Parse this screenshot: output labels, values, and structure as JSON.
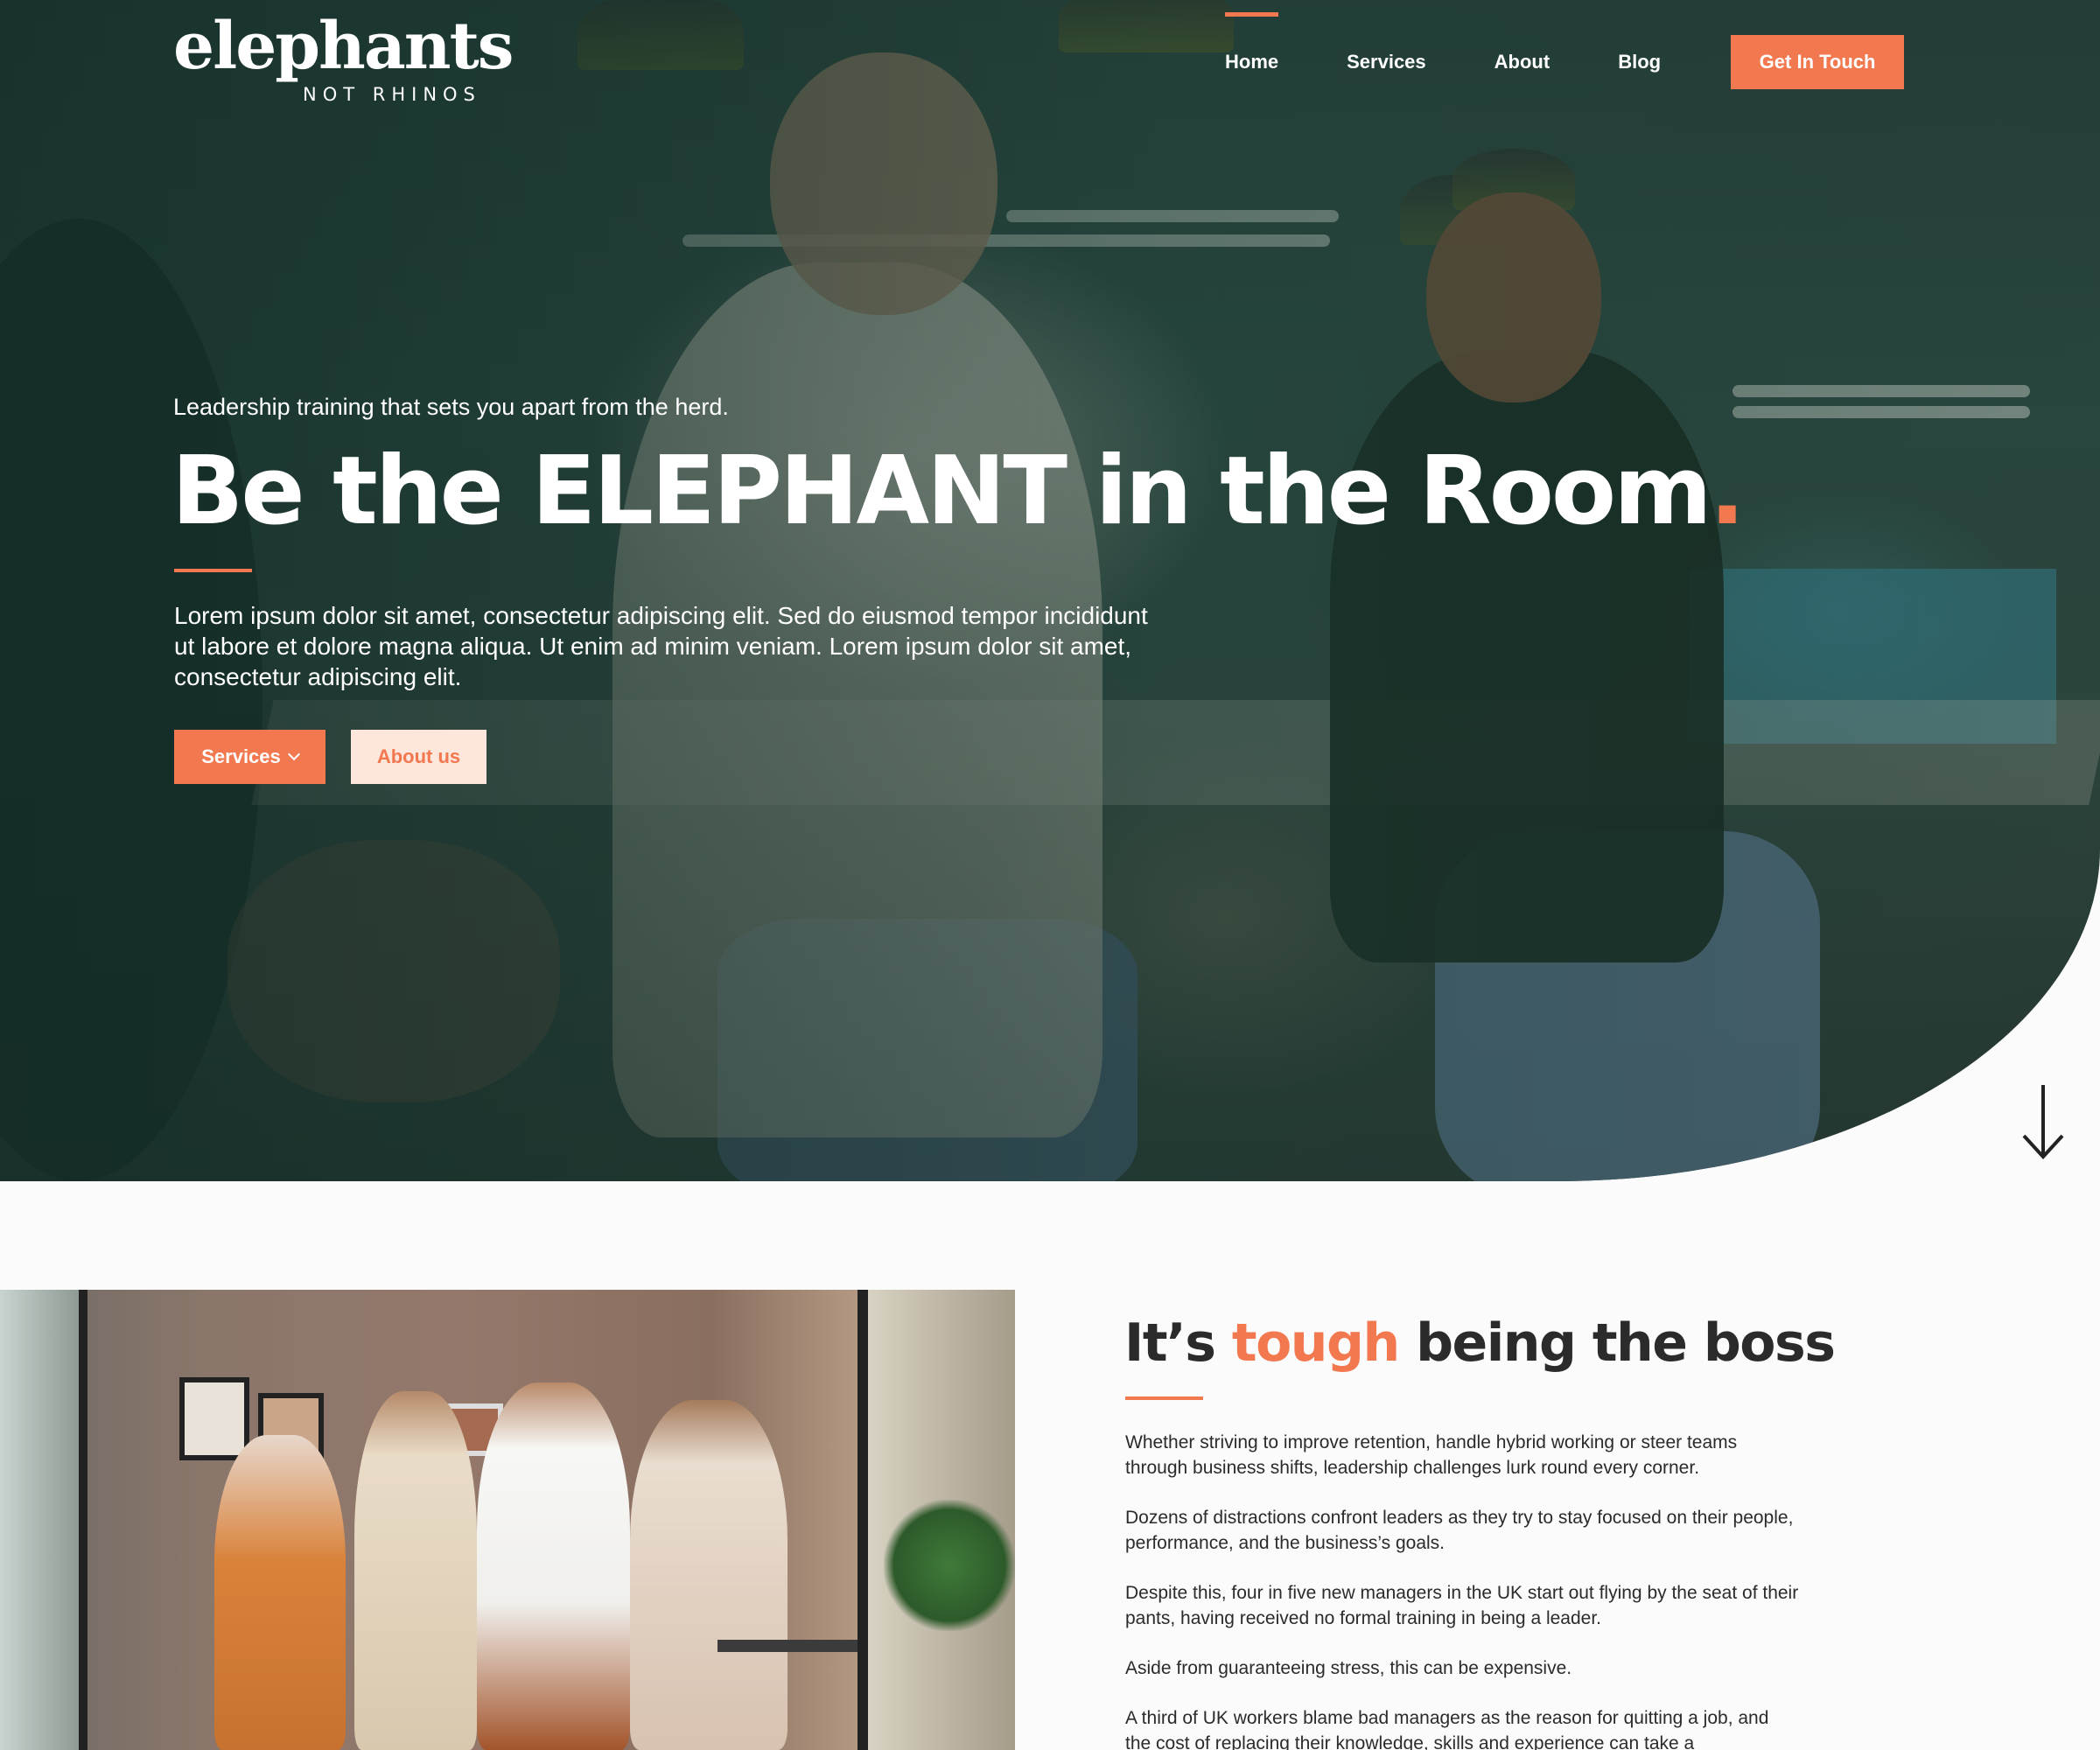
{
  "brand": {
    "logo_main": "elephants",
    "logo_sub": "NOT RHINOS",
    "accent_color": "#f2784f"
  },
  "nav": {
    "items": [
      "Home",
      "Services",
      "About",
      "Blog"
    ],
    "active": "Home",
    "cta": "Get In Touch"
  },
  "hero": {
    "tagline": "Leadership training that sets you apart from the herd.",
    "title": "Be the ELEPHANT in the Room",
    "title_dot": ".",
    "body": "Lorem ipsum dolor sit amet, consectetur adipiscing elit. Sed do eiusmod tempor incididunt ut labore et dolore magna aliqua. Ut enim ad minim veniam. Lorem ipsum dolor sit amet, consectetur adipiscing elit.",
    "btn_services": "Services",
    "btn_about": "About us",
    "scroll_icon": "arrow-down-icon"
  },
  "intro": {
    "title_pre": "It’s ",
    "title_accent": "tough",
    "title_post": " being the boss",
    "paragraphs": [
      "Whether striving to improve retention, handle hybrid working or steer teams through business shifts, leadership challenges lurk round every corner.",
      "Dozens of distractions confront leaders as they try to stay focused on their people, performance, and the business’s goals.",
      "Despite this, four in five new managers in the UK start out flying by the seat of their pants, having received no formal training in being a leader.",
      "Aside from guaranteeing stress, this can be expensive.",
      "A third of UK workers blame bad managers as the reason for quitting a job, and the cost of replacing their knowledge, skills and experience can take a"
    ]
  }
}
